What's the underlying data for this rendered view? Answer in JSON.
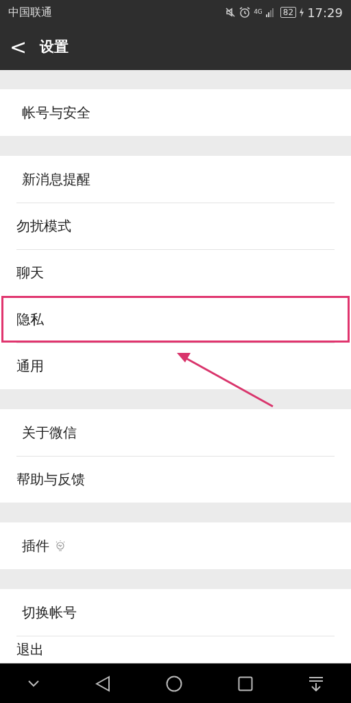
{
  "status_bar": {
    "carrier": "中国联通",
    "network": "4G",
    "battery": "82",
    "time": "17:29"
  },
  "header": {
    "back": "<",
    "title": "设置"
  },
  "groups": [
    {
      "items": [
        {
          "label": "帐号与安全",
          "kind": "plain",
          "highlighted": false
        }
      ]
    },
    {
      "items": [
        {
          "label": "新消息提醒",
          "kind": "plain",
          "highlighted": false
        },
        {
          "label": "勿扰模式",
          "kind": "plain",
          "highlighted": false
        },
        {
          "label": "聊天",
          "kind": "plain",
          "highlighted": false
        },
        {
          "label": "隐私",
          "kind": "plain",
          "highlighted": true
        },
        {
          "label": "通用",
          "kind": "plain",
          "highlighted": false
        }
      ]
    },
    {
      "items": [
        {
          "label": "关于微信",
          "kind": "plain",
          "highlighted": false
        },
        {
          "label": "帮助与反馈",
          "kind": "plain",
          "highlighted": false
        }
      ]
    },
    {
      "items": [
        {
          "label": "插件",
          "kind": "bulb",
          "highlighted": false
        }
      ]
    },
    {
      "items": [
        {
          "label": "切换帐号",
          "kind": "plain",
          "highlighted": false
        },
        {
          "label": "退出",
          "kind": "plain",
          "highlighted": false
        }
      ]
    }
  ]
}
